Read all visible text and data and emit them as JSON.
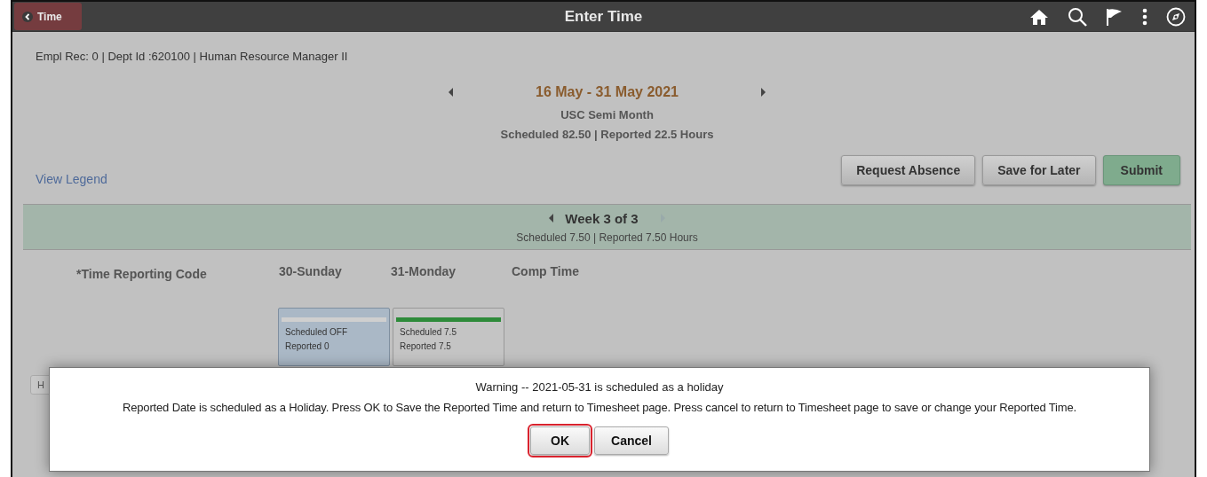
{
  "header": {
    "back_button": "Time",
    "title": "Enter Time"
  },
  "employee_info": "Empl Rec: 0 | Dept Id :620100 | Human Resource Manager II",
  "period": {
    "range": "16 May - 31 May 2021",
    "schedule": "USC Semi Month",
    "summary": "Scheduled  82.50 | Reported  22.5 Hours"
  },
  "legend_link": "View Legend",
  "actions": [
    {
      "label": "Request Absence",
      "kind": "plain"
    },
    {
      "label": "Save for Later",
      "kind": "plain"
    },
    {
      "label": "Submit",
      "kind": "primary"
    }
  ],
  "week": {
    "label": "Week 3 of 3",
    "summary": "Scheduled  7.50 | Reported  7.50 Hours",
    "next_enabled": false
  },
  "columns": [
    "*Time Reporting Code",
    "30-Sunday",
    "31-Monday",
    "Comp Time"
  ],
  "days": [
    {
      "scheduled": "Scheduled OFF",
      "reported": "Reported   0",
      "selected": true,
      "color": "#cfcfcf"
    },
    {
      "scheduled": "Scheduled 7.5",
      "reported": "Reported   7.5",
      "selected": false,
      "color": "#2e8b3a"
    }
  ],
  "partial_button": "H",
  "dialog": {
    "title": "Warning -- 2021-05-31 is scheduled as  a holiday",
    "message": "Reported Date is scheduled as a Holiday. Press OK to Save the Reported Time and return to Timesheet page. Press cancel to return to Timesheet page to save or change your Reported Time.",
    "buttons": [
      {
        "label": "OK",
        "focused": true
      },
      {
        "label": "Cancel",
        "focused": false
      }
    ]
  }
}
